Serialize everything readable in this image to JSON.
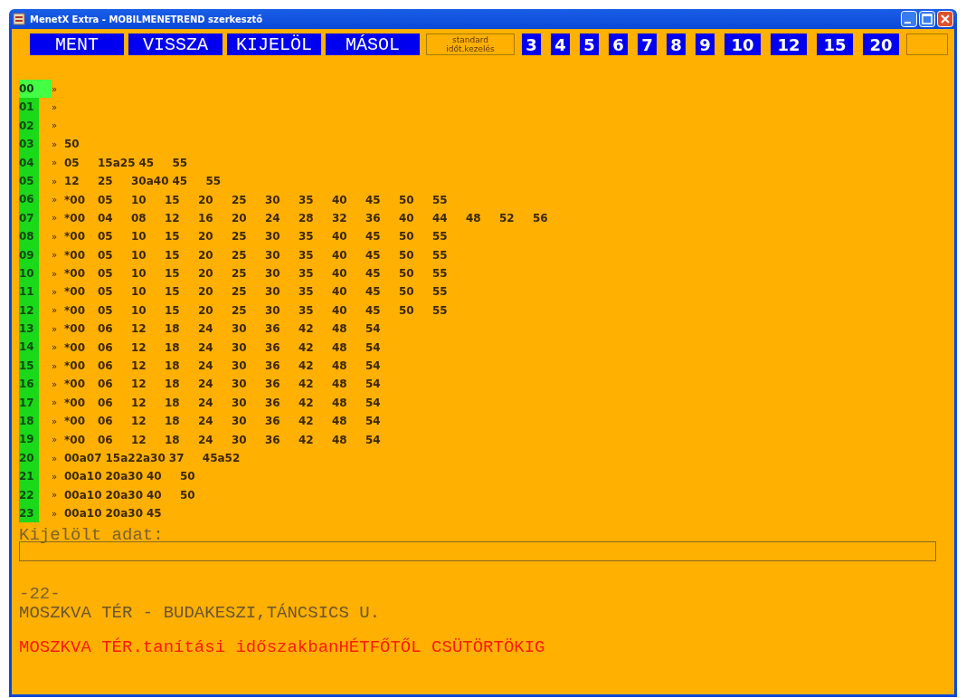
{
  "window": {
    "title": "MenetX Extra - MOBILMENETREND szerkesztő"
  },
  "toolbar": {
    "buttons": [
      "MENT",
      "VISSZA",
      "KIJELÖL",
      "MÁSOL"
    ],
    "mode_box": {
      "lines": [
        "standard",
        "időt.kezelés"
      ]
    },
    "intervals": [
      {
        "label": "3",
        "kind": "narrow"
      },
      {
        "label": "4",
        "kind": "narrow"
      },
      {
        "label": "5",
        "kind": "narrow"
      },
      {
        "label": "6",
        "kind": "narrow"
      },
      {
        "label": "7",
        "kind": "narrow"
      },
      {
        "label": "8",
        "kind": "narrow"
      },
      {
        "label": "9",
        "kind": "narrow"
      },
      {
        "label": "10",
        "kind": "wide"
      },
      {
        "label": "12",
        "kind": "wide"
      },
      {
        "label": "15",
        "kind": "wide"
      },
      {
        "label": "20",
        "kind": "wide"
      }
    ]
  },
  "schedule": {
    "rows": [
      {
        "hour": "00",
        "selected": true,
        "marker": "»",
        "times": []
      },
      {
        "hour": "01",
        "selected": false,
        "marker": "»",
        "times": []
      },
      {
        "hour": "02",
        "selected": false,
        "marker": "»",
        "times": []
      },
      {
        "hour": "03",
        "selected": false,
        "marker": "»",
        "times": [
          "50"
        ]
      },
      {
        "hour": "04",
        "selected": false,
        "marker": "»",
        "times": [
          "05",
          "15a25",
          "45",
          "55"
        ]
      },
      {
        "hour": "05",
        "selected": false,
        "marker": "»",
        "times": [
          "12",
          "25",
          "30a40",
          "45",
          "55"
        ]
      },
      {
        "hour": "06",
        "selected": false,
        "marker": "»",
        "times": [
          "*00",
          "05",
          "10",
          "15",
          "20",
          "25",
          "30",
          "35",
          "40",
          "45",
          "50",
          "55"
        ]
      },
      {
        "hour": "07",
        "selected": false,
        "marker": "»",
        "times": [
          "*00",
          "04",
          "08",
          "12",
          "16",
          "20",
          "24",
          "28",
          "32",
          "36",
          "40",
          "44",
          "48",
          "52",
          "56"
        ]
      },
      {
        "hour": "08",
        "selected": false,
        "marker": "»",
        "times": [
          "*00",
          "05",
          "10",
          "15",
          "20",
          "25",
          "30",
          "35",
          "40",
          "45",
          "50",
          "55"
        ]
      },
      {
        "hour": "09",
        "selected": false,
        "marker": "»",
        "times": [
          "*00",
          "05",
          "10",
          "15",
          "20",
          "25",
          "30",
          "35",
          "40",
          "45",
          "50",
          "55"
        ]
      },
      {
        "hour": "10",
        "selected": false,
        "marker": "»",
        "times": [
          "*00",
          "05",
          "10",
          "15",
          "20",
          "25",
          "30",
          "35",
          "40",
          "45",
          "50",
          "55"
        ]
      },
      {
        "hour": "11",
        "selected": false,
        "marker": "»",
        "times": [
          "*00",
          "05",
          "10",
          "15",
          "20",
          "25",
          "30",
          "35",
          "40",
          "45",
          "50",
          "55"
        ]
      },
      {
        "hour": "12",
        "selected": false,
        "marker": "»",
        "times": [
          "*00",
          "05",
          "10",
          "15",
          "20",
          "25",
          "30",
          "35",
          "40",
          "45",
          "50",
          "55"
        ]
      },
      {
        "hour": "13",
        "selected": false,
        "marker": "»",
        "times": [
          "*00",
          "06",
          "12",
          "18",
          "24",
          "30",
          "36",
          "42",
          "48",
          "54"
        ]
      },
      {
        "hour": "14",
        "selected": false,
        "marker": "»",
        "times": [
          "*00",
          "06",
          "12",
          "18",
          "24",
          "30",
          "36",
          "42",
          "48",
          "54"
        ]
      },
      {
        "hour": "15",
        "selected": false,
        "marker": "»",
        "times": [
          "*00",
          "06",
          "12",
          "18",
          "24",
          "30",
          "36",
          "42",
          "48",
          "54"
        ]
      },
      {
        "hour": "16",
        "selected": false,
        "marker": "»",
        "times": [
          "*00",
          "06",
          "12",
          "18",
          "24",
          "30",
          "36",
          "42",
          "48",
          "54"
        ]
      },
      {
        "hour": "17",
        "selected": false,
        "marker": "»",
        "times": [
          "*00",
          "06",
          "12",
          "18",
          "24",
          "30",
          "36",
          "42",
          "48",
          "54"
        ]
      },
      {
        "hour": "18",
        "selected": false,
        "marker": "»",
        "times": [
          "*00",
          "06",
          "12",
          "18",
          "24",
          "30",
          "36",
          "42",
          "48",
          "54"
        ]
      },
      {
        "hour": "19",
        "selected": false,
        "marker": "»",
        "times": [
          "*00",
          "06",
          "12",
          "18",
          "24",
          "30",
          "36",
          "42",
          "48",
          "54"
        ]
      },
      {
        "hour": "20",
        "selected": false,
        "marker": "»",
        "times": [
          "00a07",
          "15a22a30",
          "37",
          "45a52"
        ]
      },
      {
        "hour": "21",
        "selected": false,
        "marker": "»",
        "times": [
          "00a10",
          "20a30",
          "40",
          "50"
        ]
      },
      {
        "hour": "22",
        "selected": false,
        "marker": "»",
        "times": [
          "00a10",
          "20a30",
          "40",
          "50"
        ]
      },
      {
        "hour": "23",
        "selected": false,
        "marker": "»",
        "times": [
          "00a10",
          "20a30",
          "45"
        ]
      }
    ]
  },
  "selected_data": {
    "label": "Kijelölt adat:"
  },
  "route": {
    "number": "-22-",
    "name": "MOSZKVA TÉR - BUDAKESZI,TÁNCSICS U.",
    "note": "MOSZKVA TÉR.tanítási időszakbanHÉTFŐTŐL CSÜTÖRTÖKIG"
  }
}
